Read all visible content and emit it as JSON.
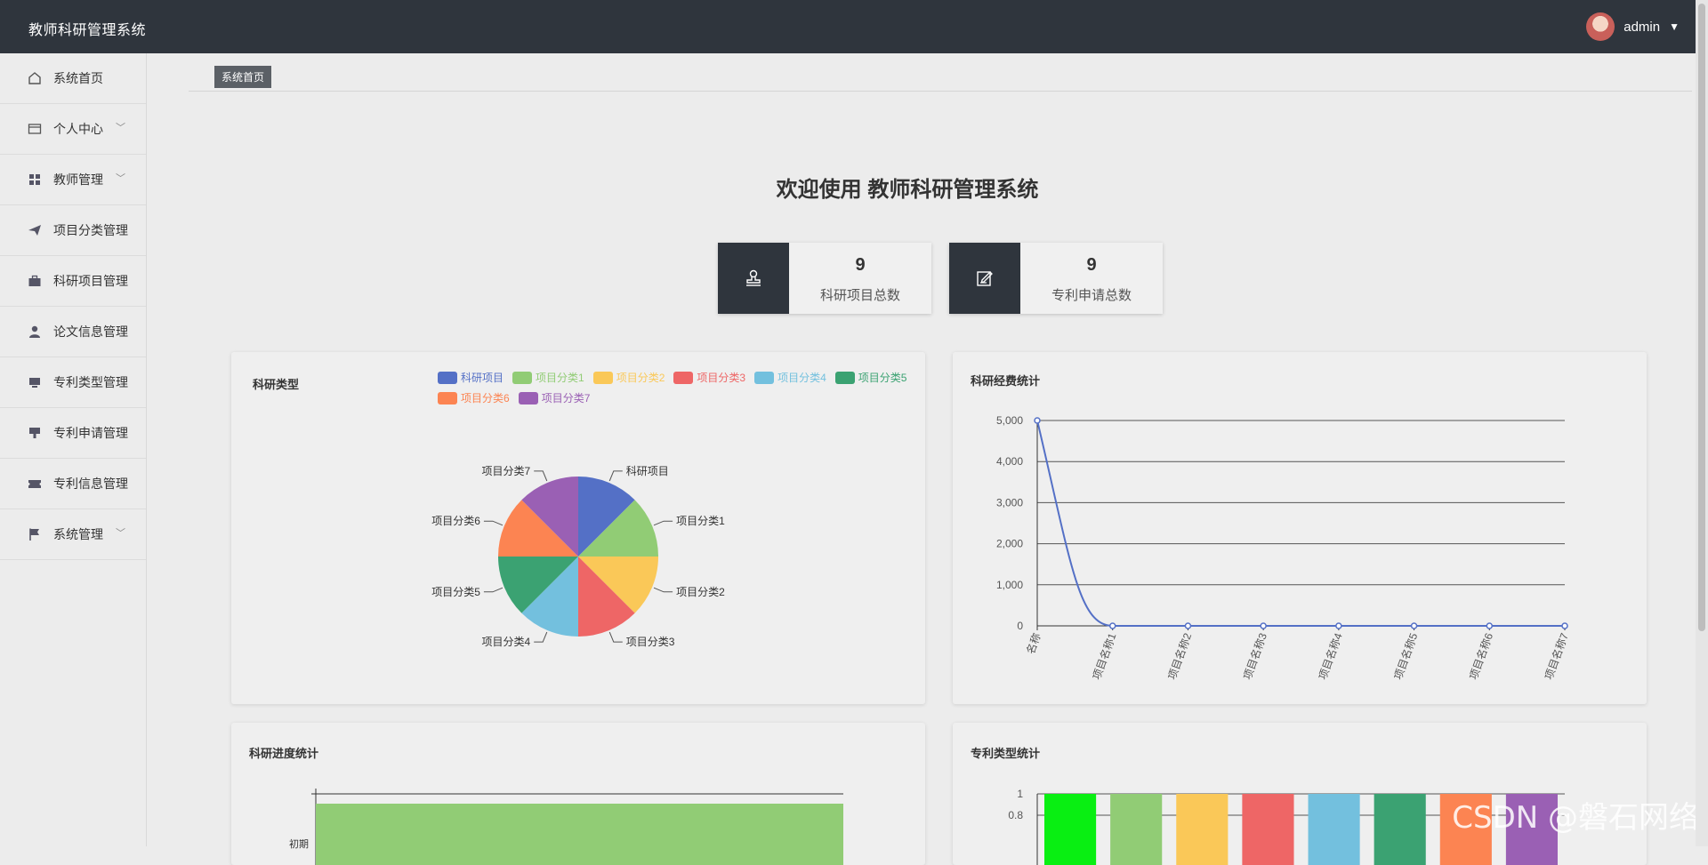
{
  "header": {
    "brand": "教师科研管理系统",
    "user": "admin"
  },
  "sidebar": {
    "items": [
      {
        "label": "系统首页",
        "icon": "home-icon",
        "expand": false
      },
      {
        "label": "个人中心",
        "icon": "card-icon",
        "expand": true
      },
      {
        "label": "教师管理",
        "icon": "grid-icon",
        "expand": true
      },
      {
        "label": "项目分类管理",
        "icon": "send-icon",
        "expand": false
      },
      {
        "label": "科研项目管理",
        "icon": "briefcase-icon",
        "expand": false
      },
      {
        "label": "论文信息管理",
        "icon": "user-icon",
        "expand": false
      },
      {
        "label": "专利类型管理",
        "icon": "monitor-icon",
        "expand": false
      },
      {
        "label": "专利申请管理",
        "icon": "flag-down-icon",
        "expand": false
      },
      {
        "label": "专利信息管理",
        "icon": "ticket-icon",
        "expand": false
      },
      {
        "label": "系统管理",
        "icon": "flag-icon",
        "expand": true
      }
    ]
  },
  "tabs": [
    {
      "label": "系统首页"
    }
  ],
  "welcome": "欢迎使用 教师科研管理系统",
  "stats": [
    {
      "value": "9",
      "label": "科研项目总数",
      "icon": "stamp-icon"
    },
    {
      "value": "9",
      "label": "专利申请总数",
      "icon": "edit-icon"
    }
  ],
  "colors": [
    "#5470c6",
    "#91cc75",
    "#fac858",
    "#ee6666",
    "#73c0de",
    "#3ba272",
    "#fc8452",
    "#9a60b4"
  ],
  "chart_data": [
    {
      "type": "pie",
      "title": "科研类型",
      "categories": [
        "科研项目",
        "项目分类1",
        "项目分类2",
        "项目分类3",
        "项目分类4",
        "项目分类5",
        "项目分类6",
        "项目分类7"
      ],
      "values": [
        1,
        1,
        1,
        1,
        1,
        1,
        1,
        1
      ],
      "legend": "top"
    },
    {
      "type": "line",
      "title": "科研经费统计",
      "x": [
        "名称",
        "项目名称1",
        "项目名称2",
        "项目名称3",
        "项目名称4",
        "项目名称5",
        "项目名称6",
        "项目名称7"
      ],
      "series": [
        {
          "values": [
            5000,
            0,
            0,
            0,
            0,
            0,
            0,
            0
          ]
        }
      ],
      "yticks": [
        "0",
        "1,000",
        "2,000",
        "3,000",
        "4,000",
        "5,000"
      ],
      "ylim": [
        0,
        5000
      ],
      "grid": true
    },
    {
      "type": "bar",
      "title": "科研进度统计",
      "categories": [
        "初期"
      ],
      "values": [
        1
      ]
    },
    {
      "type": "bar",
      "title": "专利类型统计",
      "values": [
        1,
        1,
        1,
        1,
        1,
        1,
        1,
        1
      ],
      "colors": [
        "#09ef12",
        "#91cc75",
        "#fac858",
        "#ee6666",
        "#73c0de",
        "#3ba272",
        "#fc8452",
        "#9a60b4"
      ],
      "yticks": [
        "1",
        "0.8"
      ],
      "ylim": [
        0,
        1
      ]
    }
  ],
  "watermark": "CSDN @磐石网络"
}
